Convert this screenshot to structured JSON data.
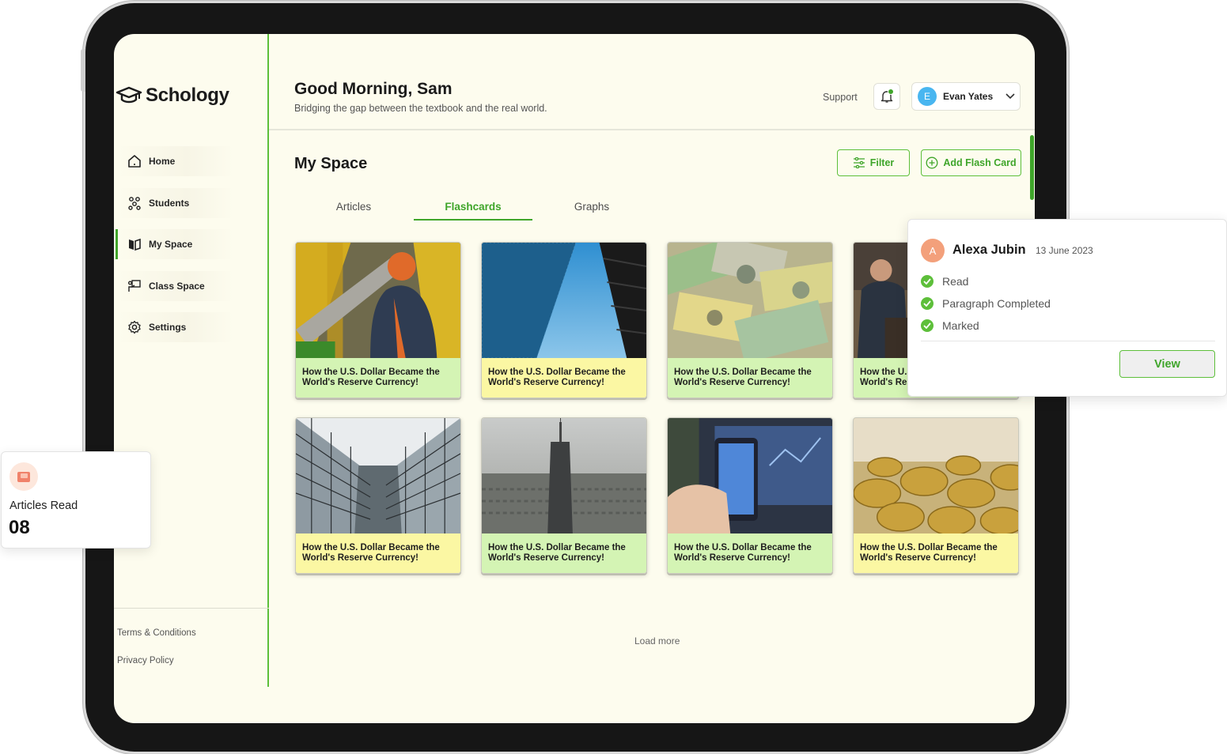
{
  "app": {
    "name": "Schology"
  },
  "sidebar": {
    "items": [
      {
        "label": "Home",
        "icon": "home-icon"
      },
      {
        "label": "Students",
        "icon": "students-icon"
      },
      {
        "label": "My Space",
        "icon": "book-icon",
        "active": true
      },
      {
        "label": "Class Space",
        "icon": "chalkboard-icon"
      },
      {
        "label": "Settings",
        "icon": "gear-icon"
      }
    ],
    "footer_links": [
      "Terms & Conditions",
      "Privacy Policy"
    ]
  },
  "header": {
    "greeting": "Good Morning, Sam",
    "subtitle": "Bridging the gap between the textbook and the real world.",
    "support_label": "Support",
    "user": {
      "initial": "E",
      "name": "Evan Yates"
    }
  },
  "main": {
    "title": "My Space",
    "filter_label": "Filter",
    "add_label": "Add Flash Card",
    "tabs": [
      {
        "label": "Articles"
      },
      {
        "label": "Flashcards",
        "active": true
      },
      {
        "label": "Graphs"
      }
    ],
    "cards": [
      {
        "title": "How the U.S. Dollar Became the World's Reserve Currency!",
        "image": "construction-worker",
        "style": "green"
      },
      {
        "title": "How the U.S. Dollar Became the World's Reserve Currency!",
        "image": "skyscrapers",
        "style": "yellow"
      },
      {
        "title": "How the U.S. Dollar Became the World's Reserve Currency!",
        "image": "banknotes",
        "style": "green"
      },
      {
        "title": "How the U.S. Dollar Became the World's Reserve Currency!",
        "image": "office-people",
        "style": "green"
      },
      {
        "title": "How the U.S. Dollar Became the World's Reserve Currency!",
        "image": "glass-building",
        "style": "yellow"
      },
      {
        "title": "How the U.S. Dollar Became the World's Reserve Currency!",
        "image": "city-tower",
        "style": "green"
      },
      {
        "title": "How the U.S. Dollar Became the World's Reserve Currency!",
        "image": "trading-phone",
        "style": "green"
      },
      {
        "title": "How the U.S. Dollar Became the World's Reserve Currency!",
        "image": "gold-coins",
        "style": "yellow"
      }
    ],
    "load_more": "Load more"
  },
  "popover": {
    "initial": "A",
    "name": "Alexa Jubin",
    "date": "13 June 2023",
    "items": [
      "Read",
      "Paragraph Completed",
      "Marked"
    ],
    "view_label": "View"
  },
  "stat": {
    "label": "Articles Read",
    "value": "08"
  },
  "colors": {
    "accent": "#3fa52a",
    "background": "#fdfcee",
    "card_green": "#d4f4b4",
    "card_yellow": "#fbf7a3"
  }
}
